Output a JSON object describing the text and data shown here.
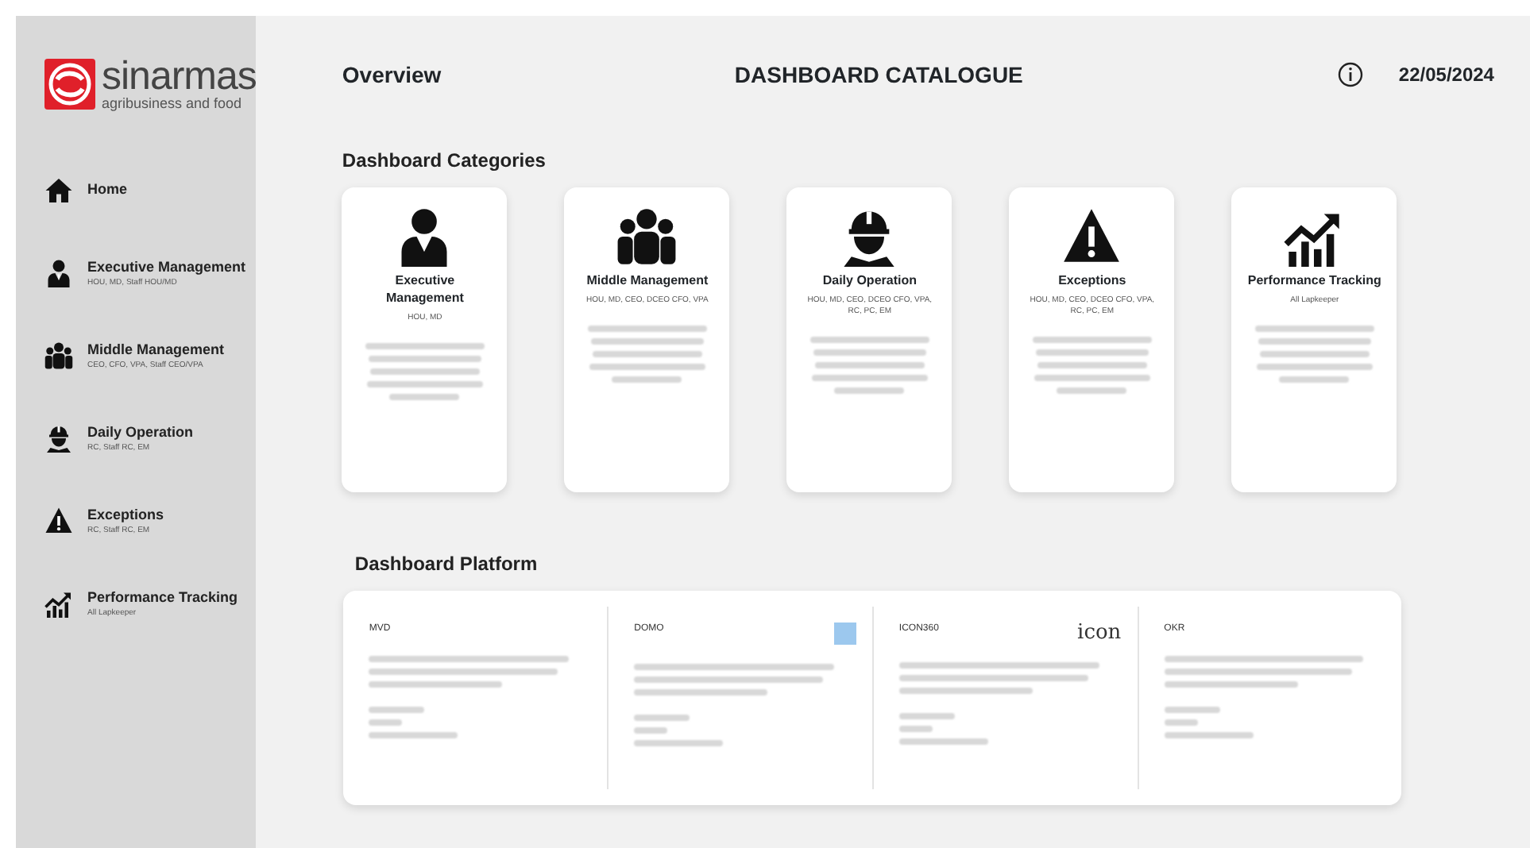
{
  "brand": {
    "name": "sinarmas",
    "tagline": "agribusiness and food"
  },
  "sidebar": {
    "items": [
      {
        "label": "Home"
      },
      {
        "label": "Executive Management",
        "sub": "HOU, MD, Staff HOU/MD"
      },
      {
        "label": "Middle Management",
        "sub": "CEO, CFO, VPA, Staff CEO/VPA"
      },
      {
        "label": "Daily Operation",
        "sub": "RC, Staff RC, EM"
      },
      {
        "label": "Exceptions",
        "sub": "RC, Staff RC, EM"
      },
      {
        "label": "Performance Tracking",
        "sub": "All Lapkeeper"
      }
    ]
  },
  "header": {
    "left": "Overview",
    "title": "DASHBOARD CATALOGUE",
    "date": "22/05/2024"
  },
  "categories": {
    "heading": "Dashboard Categories",
    "cards": [
      {
        "title": "Executive Management",
        "roles": "HOU, MD",
        "description_blurred": true
      },
      {
        "title": "Middle Management",
        "roles": "HOU, MD, CEO, DCEO CFO, VPA",
        "description_blurred": true
      },
      {
        "title": "Daily Operation",
        "roles": "HOU, MD, CEO, DCEO CFO, VPA, RC, PC, EM",
        "description_blurred": true
      },
      {
        "title": "Exceptions",
        "roles": "HOU, MD, CEO, DCEO CFO, VPA, RC, PC, EM",
        "description_blurred": true
      },
      {
        "title": "Performance Tracking",
        "roles": "All Lapkeeper",
        "description_blurred": true
      }
    ]
  },
  "platform": {
    "heading": "Dashboard Platform",
    "columns": [
      {
        "kind": "plain",
        "name": "MVD",
        "description_blurred": true
      },
      {
        "kind": "square_logo",
        "name": "DOMO",
        "description_blurred": true
      },
      {
        "kind": "text_logo",
        "name": "ICON360",
        "logo_text": "icon",
        "description_blurred": true
      },
      {
        "kind": "plain",
        "name": "OKR",
        "description_blurred": true
      }
    ]
  }
}
